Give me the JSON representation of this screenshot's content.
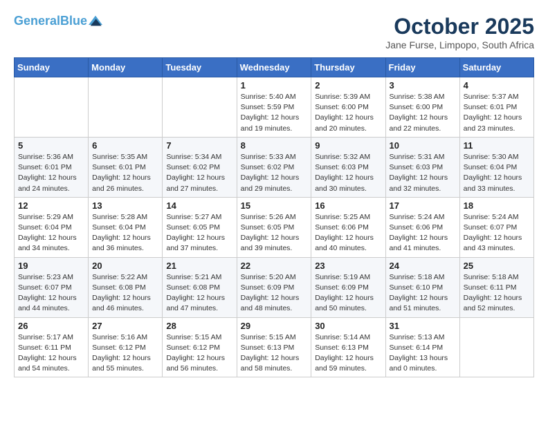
{
  "header": {
    "logo_line1": "General",
    "logo_line2": "Blue",
    "month": "October 2025",
    "location": "Jane Furse, Limpopo, South Africa"
  },
  "weekdays": [
    "Sunday",
    "Monday",
    "Tuesday",
    "Wednesday",
    "Thursday",
    "Friday",
    "Saturday"
  ],
  "weeks": [
    [
      {
        "day": "",
        "info": ""
      },
      {
        "day": "",
        "info": ""
      },
      {
        "day": "",
        "info": ""
      },
      {
        "day": "1",
        "info": "Sunrise: 5:40 AM\nSunset: 5:59 PM\nDaylight: 12 hours\nand 19 minutes."
      },
      {
        "day": "2",
        "info": "Sunrise: 5:39 AM\nSunset: 6:00 PM\nDaylight: 12 hours\nand 20 minutes."
      },
      {
        "day": "3",
        "info": "Sunrise: 5:38 AM\nSunset: 6:00 PM\nDaylight: 12 hours\nand 22 minutes."
      },
      {
        "day": "4",
        "info": "Sunrise: 5:37 AM\nSunset: 6:01 PM\nDaylight: 12 hours\nand 23 minutes."
      }
    ],
    [
      {
        "day": "5",
        "info": "Sunrise: 5:36 AM\nSunset: 6:01 PM\nDaylight: 12 hours\nand 24 minutes."
      },
      {
        "day": "6",
        "info": "Sunrise: 5:35 AM\nSunset: 6:01 PM\nDaylight: 12 hours\nand 26 minutes."
      },
      {
        "day": "7",
        "info": "Sunrise: 5:34 AM\nSunset: 6:02 PM\nDaylight: 12 hours\nand 27 minutes."
      },
      {
        "day": "8",
        "info": "Sunrise: 5:33 AM\nSunset: 6:02 PM\nDaylight: 12 hours\nand 29 minutes."
      },
      {
        "day": "9",
        "info": "Sunrise: 5:32 AM\nSunset: 6:03 PM\nDaylight: 12 hours\nand 30 minutes."
      },
      {
        "day": "10",
        "info": "Sunrise: 5:31 AM\nSunset: 6:03 PM\nDaylight: 12 hours\nand 32 minutes."
      },
      {
        "day": "11",
        "info": "Sunrise: 5:30 AM\nSunset: 6:04 PM\nDaylight: 12 hours\nand 33 minutes."
      }
    ],
    [
      {
        "day": "12",
        "info": "Sunrise: 5:29 AM\nSunset: 6:04 PM\nDaylight: 12 hours\nand 34 minutes."
      },
      {
        "day": "13",
        "info": "Sunrise: 5:28 AM\nSunset: 6:04 PM\nDaylight: 12 hours\nand 36 minutes."
      },
      {
        "day": "14",
        "info": "Sunrise: 5:27 AM\nSunset: 6:05 PM\nDaylight: 12 hours\nand 37 minutes."
      },
      {
        "day": "15",
        "info": "Sunrise: 5:26 AM\nSunset: 6:05 PM\nDaylight: 12 hours\nand 39 minutes."
      },
      {
        "day": "16",
        "info": "Sunrise: 5:25 AM\nSunset: 6:06 PM\nDaylight: 12 hours\nand 40 minutes."
      },
      {
        "day": "17",
        "info": "Sunrise: 5:24 AM\nSunset: 6:06 PM\nDaylight: 12 hours\nand 41 minutes."
      },
      {
        "day": "18",
        "info": "Sunrise: 5:24 AM\nSunset: 6:07 PM\nDaylight: 12 hours\nand 43 minutes."
      }
    ],
    [
      {
        "day": "19",
        "info": "Sunrise: 5:23 AM\nSunset: 6:07 PM\nDaylight: 12 hours\nand 44 minutes."
      },
      {
        "day": "20",
        "info": "Sunrise: 5:22 AM\nSunset: 6:08 PM\nDaylight: 12 hours\nand 46 minutes."
      },
      {
        "day": "21",
        "info": "Sunrise: 5:21 AM\nSunset: 6:08 PM\nDaylight: 12 hours\nand 47 minutes."
      },
      {
        "day": "22",
        "info": "Sunrise: 5:20 AM\nSunset: 6:09 PM\nDaylight: 12 hours\nand 48 minutes."
      },
      {
        "day": "23",
        "info": "Sunrise: 5:19 AM\nSunset: 6:09 PM\nDaylight: 12 hours\nand 50 minutes."
      },
      {
        "day": "24",
        "info": "Sunrise: 5:18 AM\nSunset: 6:10 PM\nDaylight: 12 hours\nand 51 minutes."
      },
      {
        "day": "25",
        "info": "Sunrise: 5:18 AM\nSunset: 6:11 PM\nDaylight: 12 hours\nand 52 minutes."
      }
    ],
    [
      {
        "day": "26",
        "info": "Sunrise: 5:17 AM\nSunset: 6:11 PM\nDaylight: 12 hours\nand 54 minutes."
      },
      {
        "day": "27",
        "info": "Sunrise: 5:16 AM\nSunset: 6:12 PM\nDaylight: 12 hours\nand 55 minutes."
      },
      {
        "day": "28",
        "info": "Sunrise: 5:15 AM\nSunset: 6:12 PM\nDaylight: 12 hours\nand 56 minutes."
      },
      {
        "day": "29",
        "info": "Sunrise: 5:15 AM\nSunset: 6:13 PM\nDaylight: 12 hours\nand 58 minutes."
      },
      {
        "day": "30",
        "info": "Sunrise: 5:14 AM\nSunset: 6:13 PM\nDaylight: 12 hours\nand 59 minutes."
      },
      {
        "day": "31",
        "info": "Sunrise: 5:13 AM\nSunset: 6:14 PM\nDaylight: 13 hours\nand 0 minutes."
      },
      {
        "day": "",
        "info": ""
      }
    ]
  ]
}
